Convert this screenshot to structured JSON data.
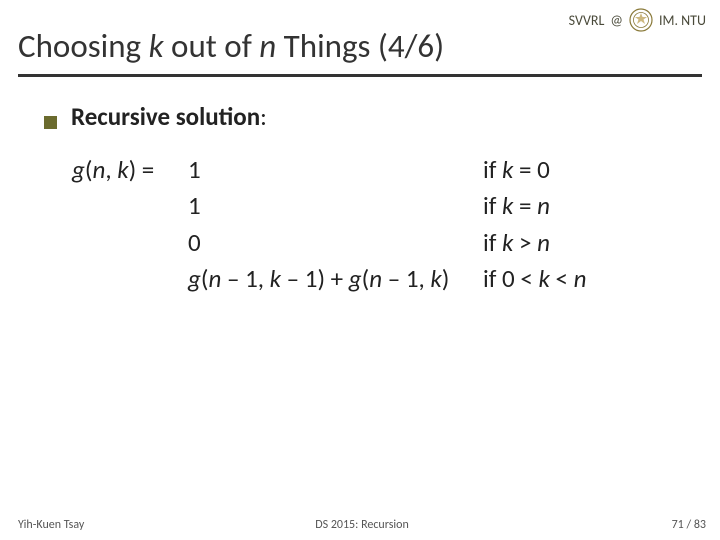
{
  "header": {
    "svvrl": "SVVRL",
    "at": "@",
    "institute": "IM. NTU"
  },
  "title": {
    "pre": "Choosing ",
    "k": "k",
    "mid1": " out of ",
    "n": "n",
    "post": " Things (4/6)"
  },
  "subhead": {
    "label": "Recursive solution",
    "colon": ":"
  },
  "math": {
    "row1_lhs_g": "g",
    "row1_lhs_open": "(",
    "row1_lhs_n": "n",
    "row1_lhs_comma": ", ",
    "row1_lhs_k": "k",
    "row1_lhs_close": ")  =  ",
    "row1_expr": "1",
    "row1_cond_if": "if ",
    "row1_cond_k": "k",
    "row1_cond_rest": " = 0",
    "row2_expr": "1",
    "row2_cond_if": "if ",
    "row2_cond_k": "k",
    "row2_cond_eq": " = ",
    "row2_cond_n": "n",
    "row3_expr": "0",
    "row3_cond_if": " if ",
    "row3_cond_k": "k",
    "row3_cond_gt": " > ",
    "row3_cond_n": "n",
    "row4_g1": "g",
    "row4_open1": "(",
    "row4_n1": "n",
    "row4_m1": " – 1, ",
    "row4_k1": "k",
    "row4_m1b": " – 1) + ",
    "row4_g2": "g",
    "row4_open2": "(",
    "row4_n2": "n",
    "row4_m2": " – 1, ",
    "row4_k2": "k",
    "row4_close2": ")",
    "row4_cond_if": "if 0 < ",
    "row4_cond_k": "k",
    "row4_cond_lt": " < ",
    "row4_cond_n": "n"
  },
  "footer": {
    "left": "Yih-Kuen Tsay",
    "mid": "DS 2015: Recursion",
    "right": "71 / 83"
  }
}
